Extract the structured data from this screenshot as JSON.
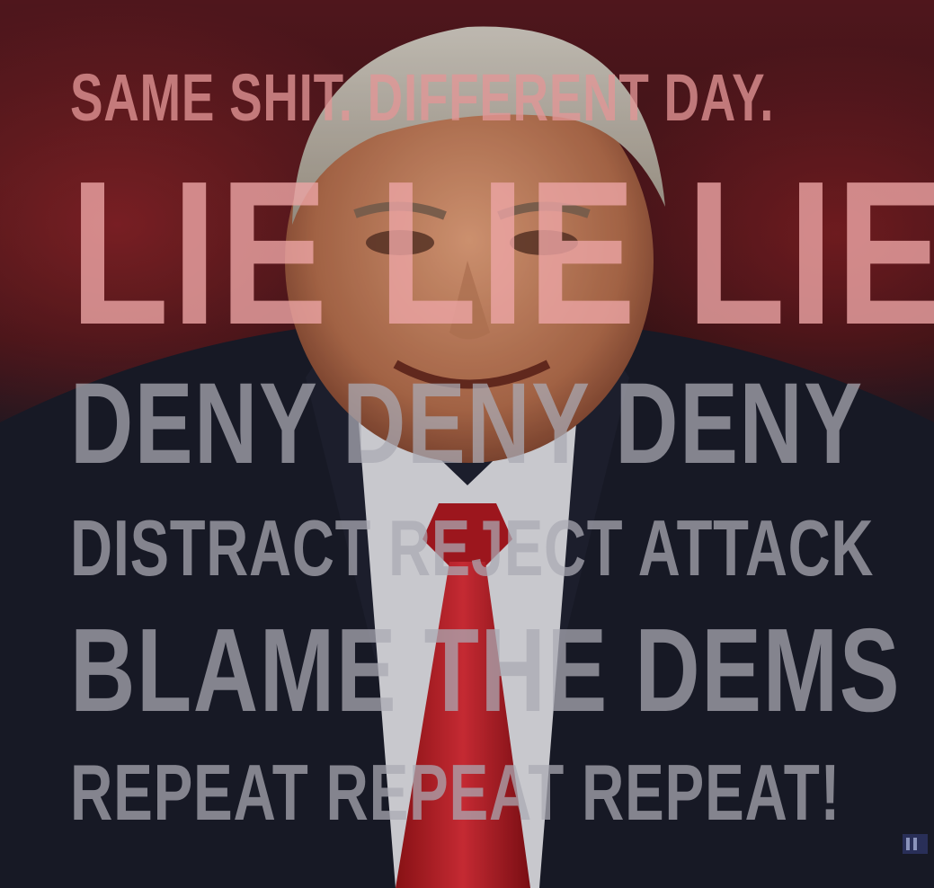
{
  "meme": {
    "lines": [
      "SAME SHIT. DIFFERENT DAY.",
      "LIE LIE LIE",
      "DENY DENY DENY",
      "DISTRACT REJECT ATTACK",
      "BLAME THE DEMS",
      "REPEAT REPEAT REPEAT!"
    ]
  },
  "colors": {
    "headline_red": "#e6a0a0",
    "body_gray": "#aaaab4",
    "tie_red": "#c0202a",
    "suit_navy": "#1d1e2a"
  }
}
